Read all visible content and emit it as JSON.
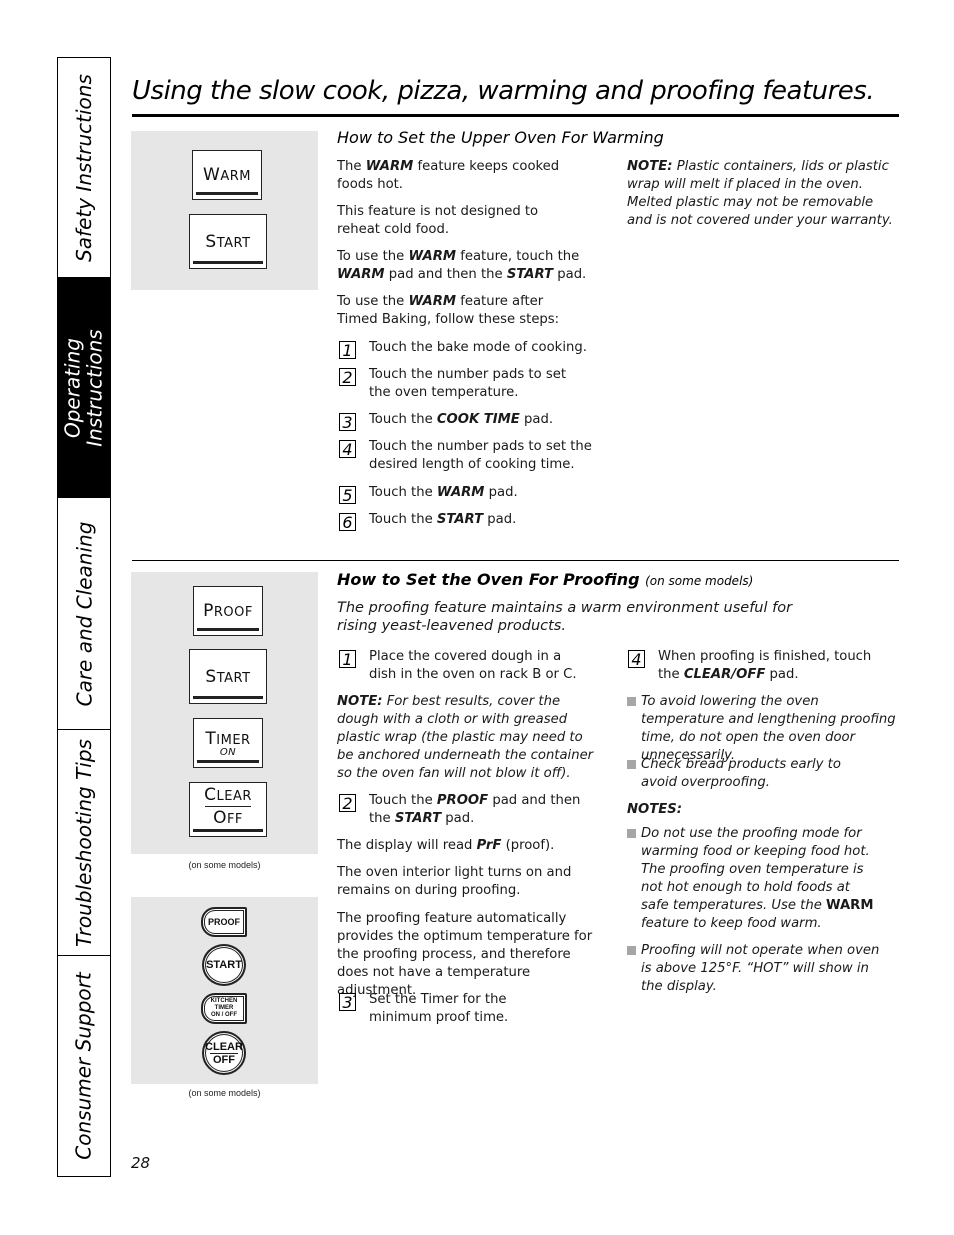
{
  "sidebar": {
    "tabs": [
      {
        "label": "Safety Instructions",
        "active": false
      },
      {
        "label": "Operating Instructions",
        "line1": "Operating",
        "line2": "Instructions",
        "active": true
      },
      {
        "label": "Care and Cleaning",
        "active": false
      },
      {
        "label": "Troubleshooting Tips",
        "active": false
      },
      {
        "label": "Consumer Support",
        "active": false
      }
    ]
  },
  "title": "Using the slow cook, pizza, warming and proofing features.",
  "warming": {
    "heading": "How to Set the Upper Oven For Warming",
    "pads": [
      {
        "first": "W",
        "rest": "ARM"
      },
      {
        "first": "S",
        "rest": "TART"
      }
    ],
    "para1": {
      "pre": "The ",
      "b1": "WARM",
      "post": " feature keeps cooked foods hot."
    },
    "para2": "This feature is not designed to reheat cold food.",
    "para3": {
      "pre": "To use the ",
      "b1": "WARM",
      "mid": " feature, touch the ",
      "b2": "WARM",
      "mid2": " pad and then the ",
      "b3": "START",
      "post": " pad."
    },
    "para4": {
      "pre": "To use the ",
      "b1": "WARM",
      "post": " feature after Timed Baking, follow these steps:"
    },
    "steps": [
      {
        "n": "1",
        "text": "Touch the bake mode of cooking."
      },
      {
        "n": "2",
        "text": "Touch the number pads to set the oven temperature."
      },
      {
        "n": "3",
        "pre": "Touch the ",
        "b": "COOK TIME",
        "post": " pad."
      },
      {
        "n": "4",
        "text": "Touch the number pads to set the desired length of cooking time."
      },
      {
        "n": "5",
        "pre": "Touch the ",
        "b": "WARM",
        "post": " pad."
      },
      {
        "n": "6",
        "pre": "Touch the ",
        "b": "START",
        "post": " pad."
      }
    ],
    "note": {
      "label": "NOTE:",
      "text": " Plastic containers, lids or plastic wrap will melt if placed in the oven. Melted plastic may not be removable and is not covered under your warranty."
    }
  },
  "proofing": {
    "heading": "How to Set the Oven For Proofing",
    "heading_suffix": "(on some models)",
    "intro": "The proofing feature maintains a warm environment useful for rising yeast-leavened products.",
    "pads": {
      "proof": {
        "first": "P",
        "rest": "ROOF"
      },
      "start": {
        "first": "S",
        "rest": "TART"
      },
      "timer": {
        "first": "T",
        "rest": "IMER",
        "sub": "ON"
      },
      "clear": {
        "first": "C",
        "rest": "LEAR",
        "first2": "O",
        "rest2": "FF"
      }
    },
    "pads_caption": "(on some models)",
    "alt_pads": {
      "proof": "PROOF",
      "start": "START",
      "timer_l1": "KITCHEN",
      "timer_l2": "TIMER",
      "timer_l3": "ON / OFF",
      "clear_l1": "CLEAR",
      "clear_l2": "OFF"
    },
    "alt_caption": "(on some models)",
    "step1": {
      "n": "1",
      "text": "Place the covered dough in a dish in the oven on rack B or C."
    },
    "note": {
      "label": "NOTE:",
      "text": " For best results, cover the dough with a cloth or with greased plastic wrap (the plastic may need to be anchored underneath the container so the oven fan will not blow it off)."
    },
    "step2": {
      "n": "2",
      "pre": "Touch the ",
      "b1": "PROOF",
      "mid": "  pad and then the ",
      "b2": "START",
      "post": " pad."
    },
    "display": {
      "pre": "The display will read ",
      "b": "PrF",
      "post": " (proof)."
    },
    "light": "The oven interior light turns on and remains on during proofing.",
    "auto": "The proofing feature automatically provides the optimum temperature for the proofing process, and therefore does not have a temperature adjustment.",
    "step3": {
      "n": "3",
      "text": "Set the Timer for the minimum proof time."
    },
    "step4": {
      "n": "4",
      "pre": "When proofing is finished, touch the ",
      "b": "CLEAR/OFF",
      "post": " pad."
    },
    "bullets": [
      "To avoid lowering the oven temperature and lengthening proofing time, do not open the oven door unnecessarily.",
      "Check bread products early to avoid overproofing."
    ],
    "notes_label": "NOTES:",
    "notes": [
      {
        "pre": "Do not use the proofing mode for warming food or keeping food hot. The proofing oven temperature is not hot enough to hold foods at safe temperatures. Use the ",
        "b": "WARM",
        "post": " feature to keep food warm."
      },
      {
        "text": "Proofing will not operate when oven is above 125°F. “HOT” will show in the display."
      }
    ]
  },
  "page_number": "28"
}
